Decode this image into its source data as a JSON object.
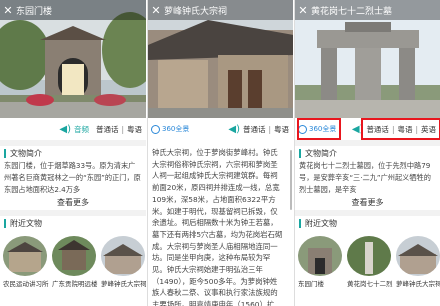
{
  "screens": [
    {
      "title": "东园门楼",
      "close": "✕",
      "audio": {
        "label": "音频",
        "mandarin": "普通话",
        "cantonese": "粤语"
      },
      "sections": {
        "intro": "文物简介",
        "intro_text": "东园门楼，位于烟草路33号。原为清末广州著名巨商黄冠林之一的“东园”的正门，原东园占地面积达2.4万多",
        "more": "查看更多",
        "nearby": "附近文物",
        "nearby_items": [
          "农民运动讲习所",
          "广东贡院明远楼",
          "萝峰钟氏大宗祠"
        ]
      }
    },
    {
      "title": "萝峰钟氏大宗祠",
      "close": "✕",
      "pano": "360全景",
      "audio": {
        "mandarin": "普通话",
        "cantonese": "粤语"
      },
      "text": "钟氏大宗祠，位于萝岗街萝峰村。钟氏大宗祠俗称钟氏宗祠，六宗祠和萝岗圣人祠一起组成钟氏大宗祠建筑群。每祠前面20米，原四祠并排连成一线，总宽109米，深58米，占地面积6322平方米。如建于明代，现基留祠已拆毁，仅余遗址。祠后相隔数十米为钟王若墓，墓下还有两排5穴古墓，均为花岗岩石砌成。大宗祠与萝岗圣人庙相隔地连同一坊。同是坐甲向庚，这种布局较为罕见。钟氏大宗祠始建于明弘治三年（1490），距今500多年。为萝岗钟姓族人春秋二祭、议事和执行家法族规的主要场所。明嘉靖庚申年（1560）扩建，康熙年间重修，至嘉庆辛酉年（1681）大兴土木重修，道光二十年（1840）再次重"
    },
    {
      "title": "黄花岗七十二烈士墓",
      "close": "✕",
      "pano": "360全景",
      "audio": {
        "mandarin": "普通话",
        "cantonese": "粤语",
        "english": "英语"
      },
      "sections": {
        "intro": "文物简介",
        "intro_text": "黄花岗七十二烈士墓园，位于先烈中路79号，是安葬辛亥“三·二九”广州起义牺牲的烈士墓园，是辛亥",
        "more": "查看更多",
        "nearby": "附近文物",
        "nearby_items": [
          "东园门楼",
          "黄花岗七十二烈",
          "萝峰钟氏大宗祠"
        ]
      }
    }
  ]
}
